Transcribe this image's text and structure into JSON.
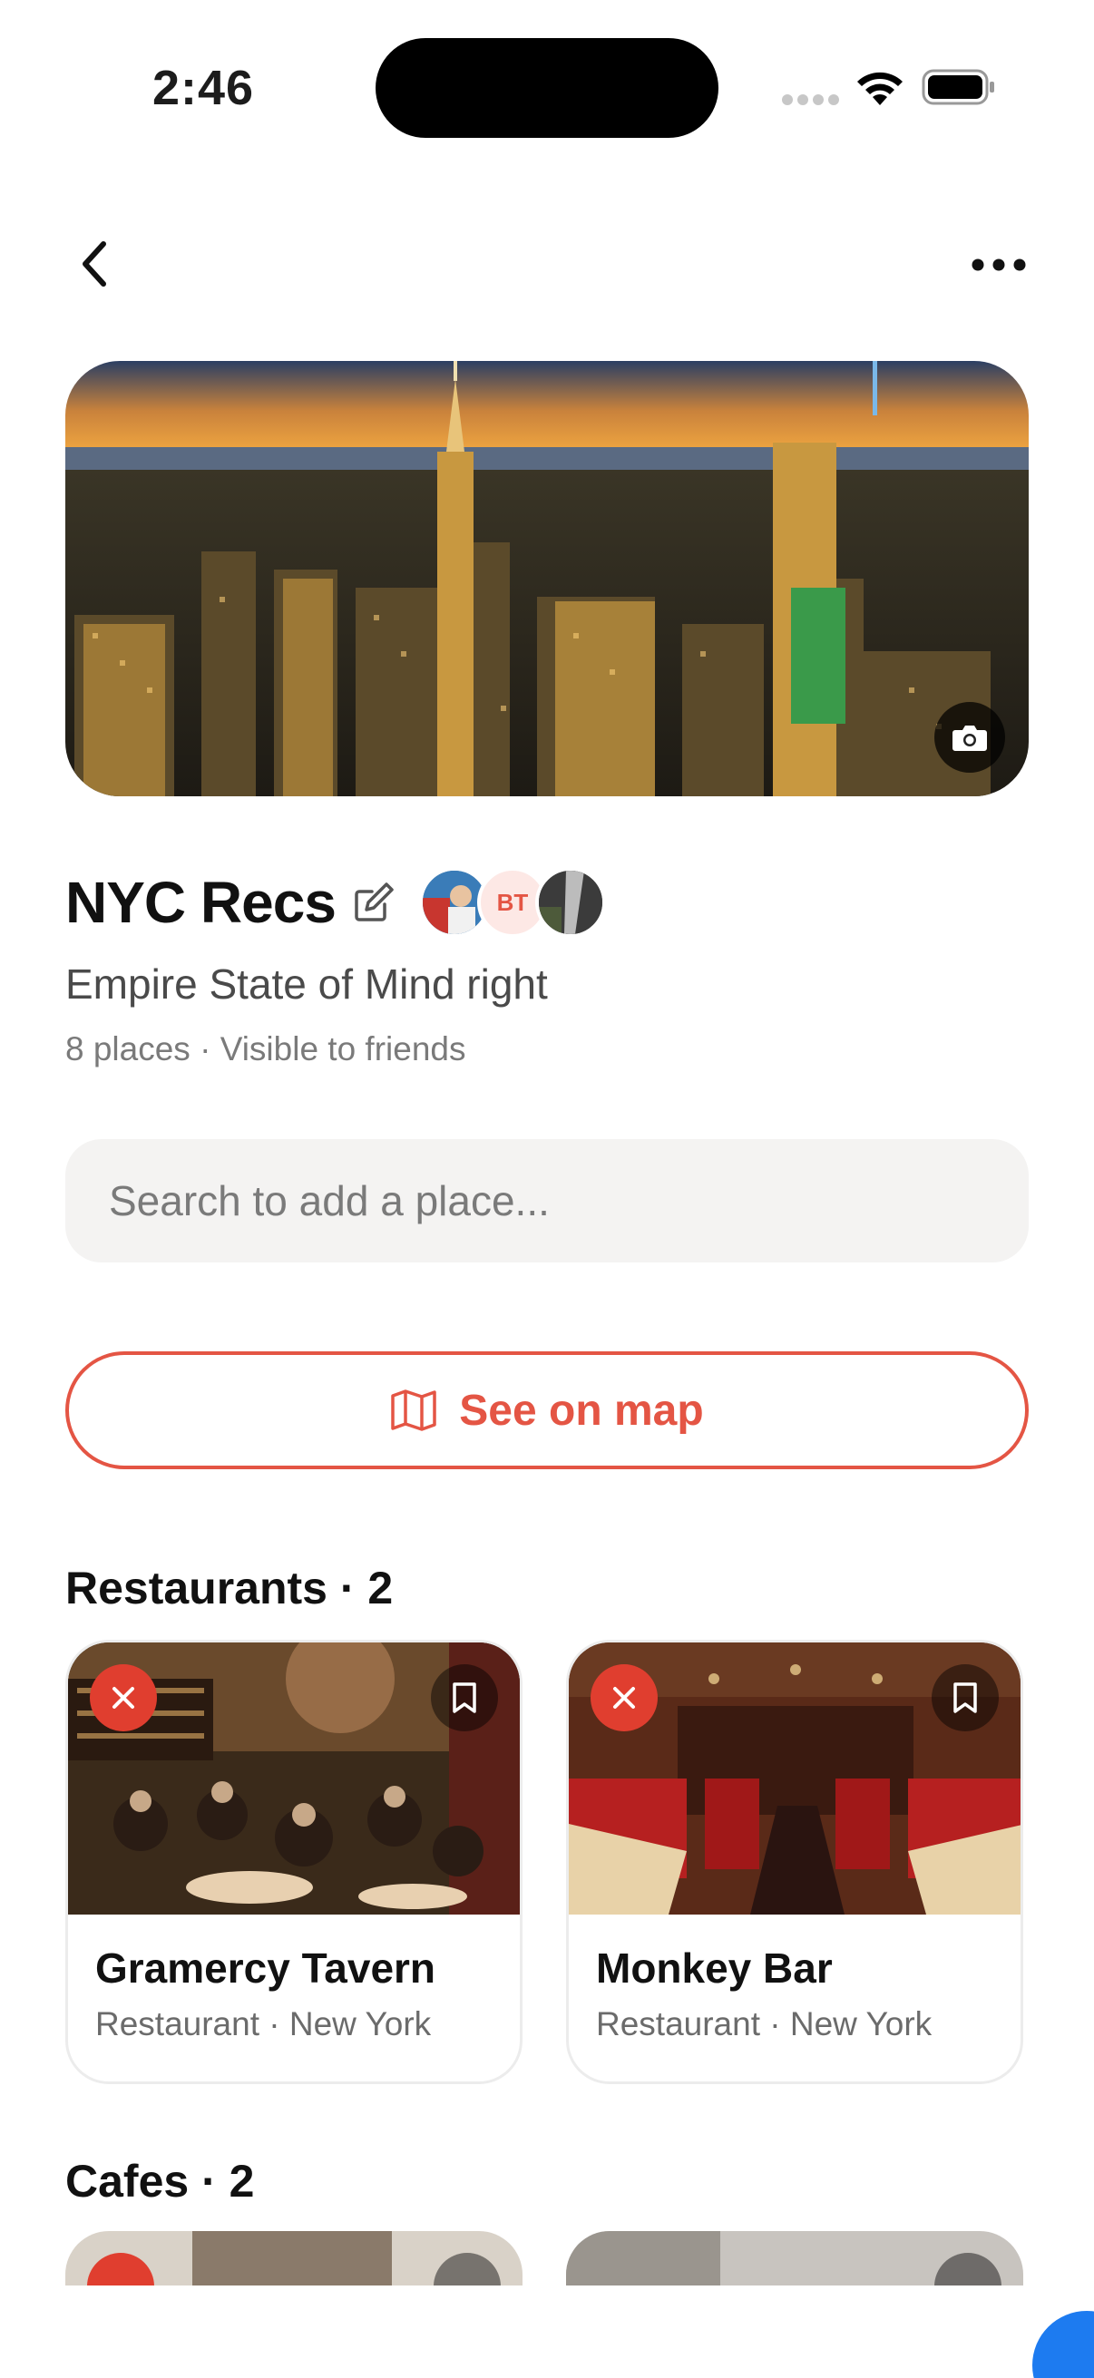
{
  "status_bar": {
    "time": "2:46"
  },
  "list": {
    "title": "NYC Recs",
    "description": "Empire State of Mind right",
    "meta": "8 places · Visible to friends",
    "collaborators": [
      {
        "type": "photo"
      },
      {
        "initials": "BT"
      },
      {
        "type": "photo"
      }
    ]
  },
  "search": {
    "placeholder": "Search to add a place..."
  },
  "map_button": {
    "label": "See on map"
  },
  "sections": [
    {
      "title": "Restaurants · 2",
      "places": [
        {
          "name": "Gramercy Tavern",
          "subtitle": "Restaurant · New York"
        },
        {
          "name": "Monkey Bar",
          "subtitle": "Restaurant · New York"
        }
      ]
    },
    {
      "title": "Cafes · 2",
      "places": []
    }
  ],
  "colors": {
    "accent": "#e45544",
    "remove": "#e03e2f",
    "search_bg": "#f4f3f2"
  },
  "icons": [
    "chevron-left-icon",
    "more-horizontal-icon",
    "camera-icon",
    "edit-icon",
    "map-icon",
    "close-icon",
    "bookmark-icon",
    "wifi-icon",
    "battery-icon"
  ]
}
